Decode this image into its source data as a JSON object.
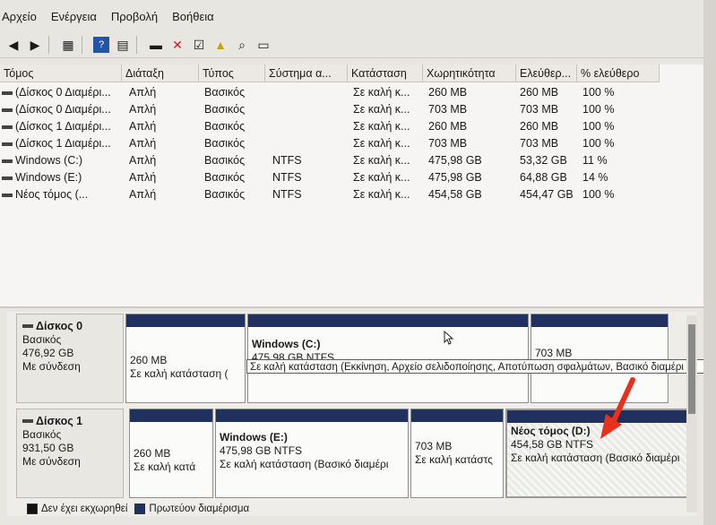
{
  "menu": [
    "Αρχείο",
    "Ενέργεια",
    "Προβολή",
    "Βοήθεια"
  ],
  "columns": [
    "Τόμος",
    "Διάταξη",
    "Τύπος",
    "Σύστημα α...",
    "Κατάσταση",
    "Χωρητικότητα",
    "Ελεύθερ...",
    "% ελεύθερο"
  ],
  "volumes": [
    {
      "name": "(Δίσκος 0 Διαμέρι...",
      "layout": "Απλή",
      "type": "Βασικός",
      "fs": "",
      "status": "Σε καλή κ...",
      "capacity": "260 MB",
      "free": "260 MB",
      "pct": "100 %"
    },
    {
      "name": "(Δίσκος 0 Διαμέρι...",
      "layout": "Απλή",
      "type": "Βασικός",
      "fs": "",
      "status": "Σε καλή κ...",
      "capacity": "703 MB",
      "free": "703 MB",
      "pct": "100 %"
    },
    {
      "name": "(Δίσκος 1 Διαμέρι...",
      "layout": "Απλή",
      "type": "Βασικός",
      "fs": "",
      "status": "Σε καλή κ...",
      "capacity": "260 MB",
      "free": "260 MB",
      "pct": "100 %"
    },
    {
      "name": "(Δίσκος 1 Διαμέρι...",
      "layout": "Απλή",
      "type": "Βασικός",
      "fs": "",
      "status": "Σε καλή κ...",
      "capacity": "703 MB",
      "free": "703 MB",
      "pct": "100 %"
    },
    {
      "name": "Windows (C:)",
      "layout": "Απλή",
      "type": "Βασικός",
      "fs": "NTFS",
      "status": "Σε καλή κ...",
      "capacity": "475,98 GB",
      "free": "53,32 GB",
      "pct": "11 %"
    },
    {
      "name": "Windows (E:)",
      "layout": "Απλή",
      "type": "Βασικός",
      "fs": "NTFS",
      "status": "Σε καλή κ...",
      "capacity": "475,98 GB",
      "free": "64,88 GB",
      "pct": "14 %"
    },
    {
      "name": "Νέος τόμος (...",
      "layout": "Απλή",
      "type": "Βασικός",
      "fs": "NTFS",
      "status": "Σε καλή κ...",
      "capacity": "454,58 GB",
      "free": "454,47 GB",
      "pct": "100 %"
    }
  ],
  "disk0": {
    "name": "Δίσκος 0",
    "kind": "Βασικός",
    "size": "476,92 GB",
    "state": "Με σύνδεση",
    "p1": {
      "size": "260 MB",
      "status": "Σε καλή κατάσταση ("
    },
    "p2": {
      "title": "Windows  (C:)",
      "size": "475,98 GB NTFS",
      "status": "Σε καλή κατάσταση (Εκκίνηση, Αρχείο σελιδοποίησης, Αποτύπωση σφαλμάτων, Βασικό διαμέρι"
    },
    "p3": {
      "size": "703 MB"
    }
  },
  "disk1": {
    "name": "Δίσκος 1",
    "kind": "Βασικός",
    "size": "931,50 GB",
    "state": "Με σύνδεση",
    "p1": {
      "size": "260 MB",
      "status": "Σε καλή κατά"
    },
    "p2": {
      "title": "Windows  (E:)",
      "size": "475,98 GB NTFS",
      "status": "Σε καλή κατάσταση (Βασικό διαμέρι"
    },
    "p3": {
      "size": "703 MB",
      "status": "Σε καλή κατάστς"
    },
    "p4": {
      "title": "Νέος τόμος  (D:)",
      "size": "454,58 GB NTFS",
      "status": "Σε καλή κατάσταση (Βασικό διαμέρι"
    }
  },
  "legend": {
    "unallocated": "Δεν έχει εκχωρηθεί",
    "primary": "Πρωτεύον διαμέρισμα"
  },
  "colors": {
    "primary_bar": "#20305f",
    "unallocated": "#111111",
    "arrow": "#e8301c"
  }
}
